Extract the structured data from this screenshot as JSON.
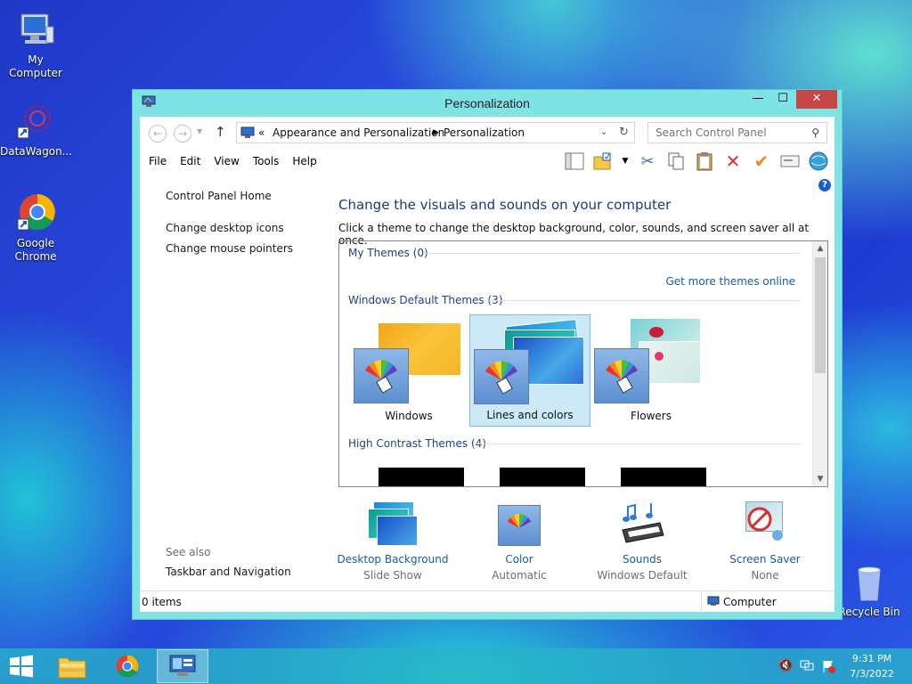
{
  "desktop": {
    "icons": [
      {
        "name": "my-computer",
        "label": "My Computer"
      },
      {
        "name": "datawagon",
        "label": "DataWagon..."
      },
      {
        "name": "google-chrome",
        "label": "Google Chrome"
      },
      {
        "name": "recycle-bin",
        "label": "Recycle Bin"
      }
    ]
  },
  "window": {
    "title": "Personalization",
    "controls": {
      "minimize": "—",
      "maximize": "☐",
      "close": "✕"
    }
  },
  "address": {
    "overflow": "«",
    "crumb1": "Appearance and Personalization",
    "crumb2": "Personalization",
    "search_placeholder": "Search Control Panel"
  },
  "menu": [
    "File",
    "Edit",
    "View",
    "Tools",
    "Help"
  ],
  "left": {
    "home": "Control Panel Home",
    "links": [
      "Change desktop icons",
      "Change mouse pointers"
    ],
    "see_also": "See also",
    "see_also_link": "Taskbar and Navigation"
  },
  "main": {
    "headline": "Change the visuals and sounds on your computer",
    "subtitle": "Click a theme to change the desktop background, color, sounds, and screen saver all at once.",
    "groups": {
      "my_themes": "My Themes (0)",
      "get_more": "Get more themes online",
      "default": "Windows Default Themes (3)",
      "high_contrast": "High Contrast Themes (4)"
    },
    "themes": [
      {
        "label": "Windows",
        "selected": false
      },
      {
        "label": "Lines and colors",
        "selected": true
      },
      {
        "label": "Flowers",
        "selected": false
      }
    ],
    "settings": [
      {
        "title": "Desktop Background",
        "value": "Slide Show"
      },
      {
        "title": "Color",
        "value": "Automatic"
      },
      {
        "title": "Sounds",
        "value": "Windows Default"
      },
      {
        "title": "Screen Saver",
        "value": "None"
      }
    ]
  },
  "status": {
    "items": "0 items",
    "location": "Computer"
  },
  "taskbar": {
    "time": "9:31 PM",
    "date": "7/3/2022"
  },
  "colors": {
    "accent": "#7fe3e6",
    "close": "#c74646",
    "link": "#1a5ab0",
    "heading": "#163a8a"
  }
}
